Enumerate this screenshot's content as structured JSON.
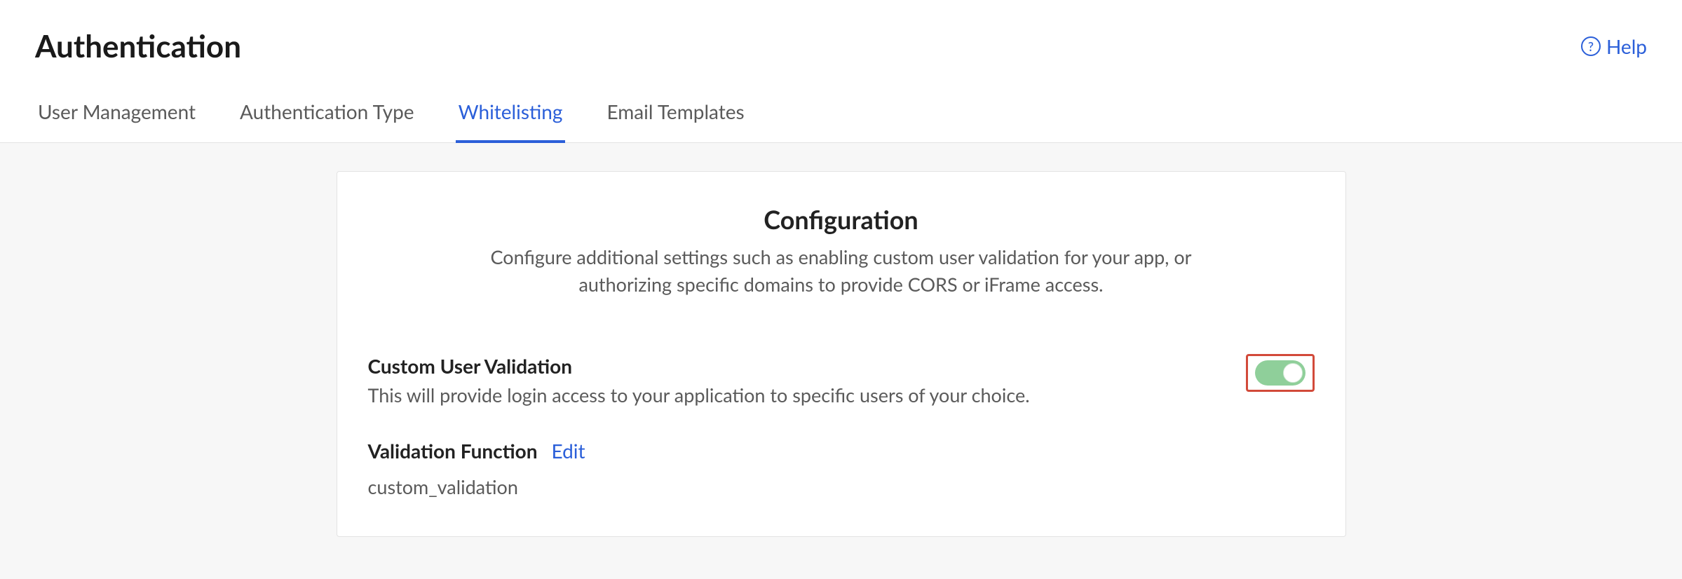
{
  "header": {
    "title": "Authentication",
    "help_label": "Help"
  },
  "tabs": [
    {
      "label": "User Management",
      "active": false
    },
    {
      "label": "Authentication Type",
      "active": false
    },
    {
      "label": "Whitelisting",
      "active": true
    },
    {
      "label": "Email Templates",
      "active": false
    }
  ],
  "config": {
    "title": "Configuration",
    "subtitle": "Configure additional settings such as enabling custom user validation for your app, or authorizing specific domains to provide CORS or iFrame access.",
    "custom_validation": {
      "label": "Custom User Validation",
      "description": "This will provide login access to your application to specific users of your choice.",
      "enabled": true
    },
    "validation_function": {
      "label": "Validation Function",
      "edit_label": "Edit",
      "value": "custom_validation"
    }
  }
}
